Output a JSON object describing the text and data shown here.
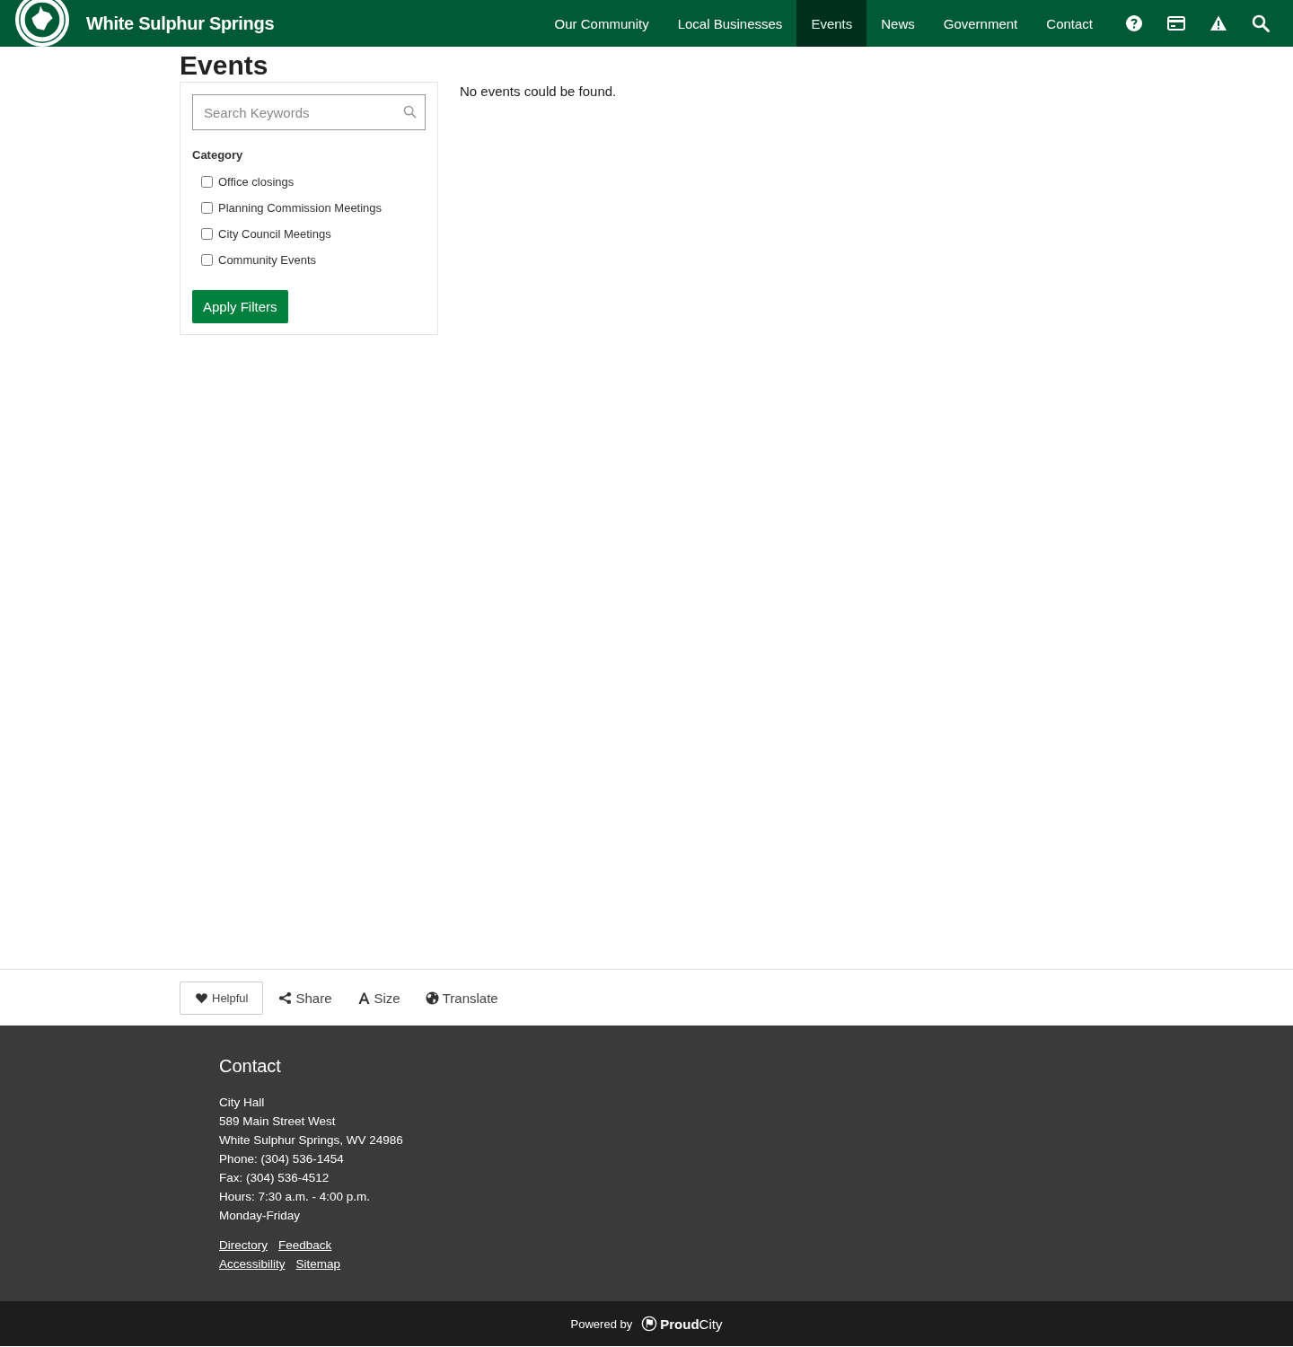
{
  "header": {
    "site_title": "White Sulphur Springs",
    "nav": [
      {
        "label": "Our Community",
        "selected": false
      },
      {
        "label": "Local Businesses",
        "selected": false
      },
      {
        "label": "Events",
        "selected": true
      },
      {
        "label": "News",
        "selected": false
      },
      {
        "label": "Government",
        "selected": false
      },
      {
        "label": "Contact",
        "selected": false
      }
    ],
    "icons": [
      {
        "kind": "help"
      },
      {
        "kind": "payment"
      },
      {
        "kind": "alert"
      },
      {
        "kind": "search"
      }
    ]
  },
  "page_title": "Events",
  "filters": {
    "search": {
      "placeholder": "Search Keywords"
    },
    "category_label": "Category",
    "categories": [
      {
        "label": "Office closings",
        "checked": false
      },
      {
        "label": "Planning Commission Meetings",
        "checked": false
      },
      {
        "label": "City Council Meetings",
        "checked": false
      },
      {
        "label": "Community Events",
        "checked": false
      }
    ],
    "apply_button": "Apply Filters"
  },
  "results_message": "No events could be found.",
  "actions": [
    {
      "kind": "helpful",
      "label": "Helpful"
    },
    {
      "kind": "share",
      "label": "Share"
    },
    {
      "kind": "size",
      "label": "Size"
    },
    {
      "kind": "translate",
      "label": "Translate"
    }
  ],
  "footer": {
    "heading": "Contact",
    "lines": [
      "City Hall",
      "589 Main Street West",
      "White Sulphur Springs, WV 24986",
      "Phone: (304) 536-1454",
      "Fax: (304) 536-4512",
      "Hours: 7:30 a.m. - 4:00 p.m.",
      "Monday-Friday"
    ],
    "link_rows": [
      [
        "Directory",
        "Feedback"
      ],
      [
        "Accessibility",
        "Sitemap"
      ]
    ]
  },
  "powered_by": {
    "label": "Powered by",
    "brand": "**Proud**City"
  }
}
